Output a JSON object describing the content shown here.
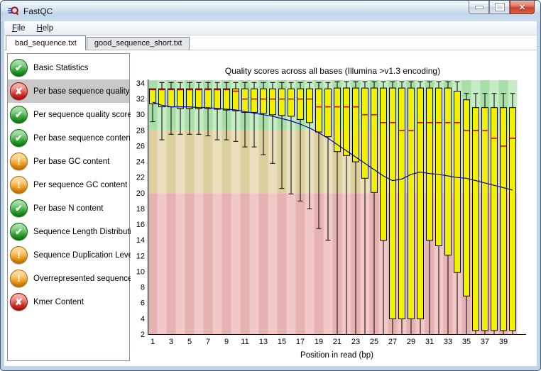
{
  "window": {
    "title": "FastQC"
  },
  "titlebar": {
    "close_glyph": "✕"
  },
  "menu": {
    "items": [
      {
        "label": "File",
        "underline_index": 0
      },
      {
        "label": "Help",
        "underline_index": 0
      }
    ]
  },
  "tabs": [
    {
      "label": "bad_sequence.txt",
      "active": true
    },
    {
      "label": "good_sequence_short.txt",
      "active": false
    }
  ],
  "sidebar": {
    "status_glyphs": {
      "pass": "✔",
      "warn": "!",
      "fail": "✘"
    },
    "items": [
      {
        "label": "Basic Statistics",
        "status": "pass",
        "selected": false
      },
      {
        "label": "Per base sequence quality",
        "status": "fail",
        "selected": true
      },
      {
        "label": "Per sequence quality scores",
        "status": "pass",
        "selected": false
      },
      {
        "label": "Per base sequence content",
        "status": "pass",
        "selected": false
      },
      {
        "label": "Per base GC content",
        "status": "warn",
        "selected": false
      },
      {
        "label": "Per sequence GC content",
        "status": "warn",
        "selected": false
      },
      {
        "label": "Per base N content",
        "status": "pass",
        "selected": false
      },
      {
        "label": "Sequence Length Distribution",
        "status": "pass",
        "selected": false
      },
      {
        "label": "Sequence Duplication Levels",
        "status": "warn",
        "selected": false
      },
      {
        "label": "Overrepresented sequences",
        "status": "warn",
        "selected": false
      },
      {
        "label": "Kmer Content",
        "status": "fail",
        "selected": false
      }
    ]
  },
  "chart_data": {
    "type": "boxplot",
    "title": "Quality scores across all bases (Illumina >v1.3 encoding)",
    "xlabel": "Position in read (bp)",
    "ylim": [
      2,
      34.4
    ],
    "y_ticks": [
      2,
      4,
      6,
      8,
      10,
      12,
      14,
      16,
      18,
      20,
      22,
      24,
      26,
      28,
      30,
      32,
      34
    ],
    "x_tick_labels": [
      "1",
      "3",
      "5",
      "7",
      "9",
      "11",
      "13",
      "15",
      "17",
      "19",
      "21",
      "23",
      "25",
      "27",
      "29",
      "31",
      "33",
      "35",
      "37",
      "39"
    ],
    "grid": false,
    "legend": "none",
    "bands": [
      {
        "name": "good-quality-band",
        "from": 28,
        "to": 34.4,
        "colors": [
          "#a8dea8",
          "#c6ecc6"
        ]
      },
      {
        "name": "ok-quality-band",
        "from": 20,
        "to": 28,
        "colors": [
          "#dccf9e",
          "#eadfbc"
        ]
      },
      {
        "name": "poor-quality-band",
        "from": 2,
        "to": 20,
        "colors": [
          "#e5b1b1",
          "#f1c7c7"
        ]
      }
    ],
    "colors": {
      "box_fill": "#f2f200",
      "box_stroke": "#000000",
      "median": "#d40000",
      "mean": "#0000a0",
      "whisker": "#000000"
    },
    "whisker_low": [
      29.1,
      26.8,
      27.5,
      27.5,
      27.5,
      27.5,
      27.3,
      26.8,
      26.8,
      26.6,
      25.9,
      25.9,
      24.9,
      23.8,
      20.6,
      19.9,
      19.0,
      18.0,
      15.5,
      14.0,
      2,
      2,
      2,
      2,
      2,
      2,
      2,
      2,
      2,
      2,
      2,
      2,
      2,
      2,
      2,
      2,
      2,
      2,
      2,
      2
    ],
    "q1": [
      31.4,
      31.0,
      31.0,
      30.8,
      30.8,
      30.8,
      30.8,
      30.7,
      30.6,
      30.5,
      30.3,
      30.3,
      30.2,
      30.0,
      29.9,
      29.8,
      29.4,
      29.0,
      27.8,
      27.2,
      25.3,
      24.8,
      24.0,
      21.9,
      20.1,
      14.0,
      4.0,
      4.0,
      4.0,
      4.0,
      14.0,
      13.3,
      12.1,
      9.9,
      6.9,
      2.5,
      2.5,
      2.5,
      2.5,
      2.5
    ],
    "median": [
      33.2,
      33.2,
      33.2,
      33.2,
      33.2,
      33.2,
      33.2,
      33.2,
      33.2,
      33.0,
      32.0,
      32.0,
      32.0,
      32.0,
      32.0,
      32.0,
      32.0,
      32.0,
      31.0,
      31.0,
      31.0,
      31.0,
      31.0,
      30.0,
      30.0,
      29.0,
      29.0,
      28.0,
      28.0,
      29.0,
      29.0,
      29.0,
      29.0,
      29.0,
      28.0,
      28.0,
      28.0,
      27.0,
      26.0,
      27.0
    ],
    "q3": [
      33.3,
      33.3,
      33.3,
      33.3,
      33.3,
      33.3,
      33.3,
      33.3,
      33.3,
      33.3,
      33.3,
      33.3,
      33.3,
      33.3,
      33.3,
      33.3,
      33.3,
      33.3,
      33.3,
      33.3,
      33.4,
      33.4,
      33.4,
      33.4,
      33.4,
      33.4,
      33.4,
      33.4,
      33.4,
      33.4,
      33.4,
      33.4,
      33.4,
      33.0,
      31.9,
      30.9,
      30.9,
      30.9,
      30.9,
      30.9
    ],
    "whisker_high": [
      33.3,
      34.1,
      34.1,
      34.1,
      34.1,
      34.1,
      34.1,
      34.1,
      34.1,
      34.1,
      34.1,
      34.1,
      34.1,
      34.1,
      34.1,
      34.1,
      34.1,
      34.1,
      34.1,
      34.1,
      34.2,
      34.2,
      34.2,
      34.2,
      34.2,
      34.2,
      34.2,
      34.2,
      34.2,
      34.2,
      34.2,
      34.2,
      34.2,
      34.2,
      32.7,
      32.7,
      32.7,
      32.7,
      32.7,
      32.7
    ],
    "mean": [
      31.6,
      31.2,
      31.0,
      31.0,
      31.0,
      30.9,
      30.9,
      30.8,
      30.7,
      30.6,
      30.4,
      30.2,
      30.0,
      29.8,
      29.5,
      29.2,
      28.8,
      28.3,
      27.7,
      27.0,
      26.2,
      25.4,
      24.6,
      23.8,
      23.0,
      22.2,
      21.6,
      21.8,
      22.4,
      22.7,
      22.5,
      22.4,
      22.2,
      22.0,
      21.9,
      21.6,
      21.3,
      21.0,
      20.7,
      20.4
    ]
  }
}
